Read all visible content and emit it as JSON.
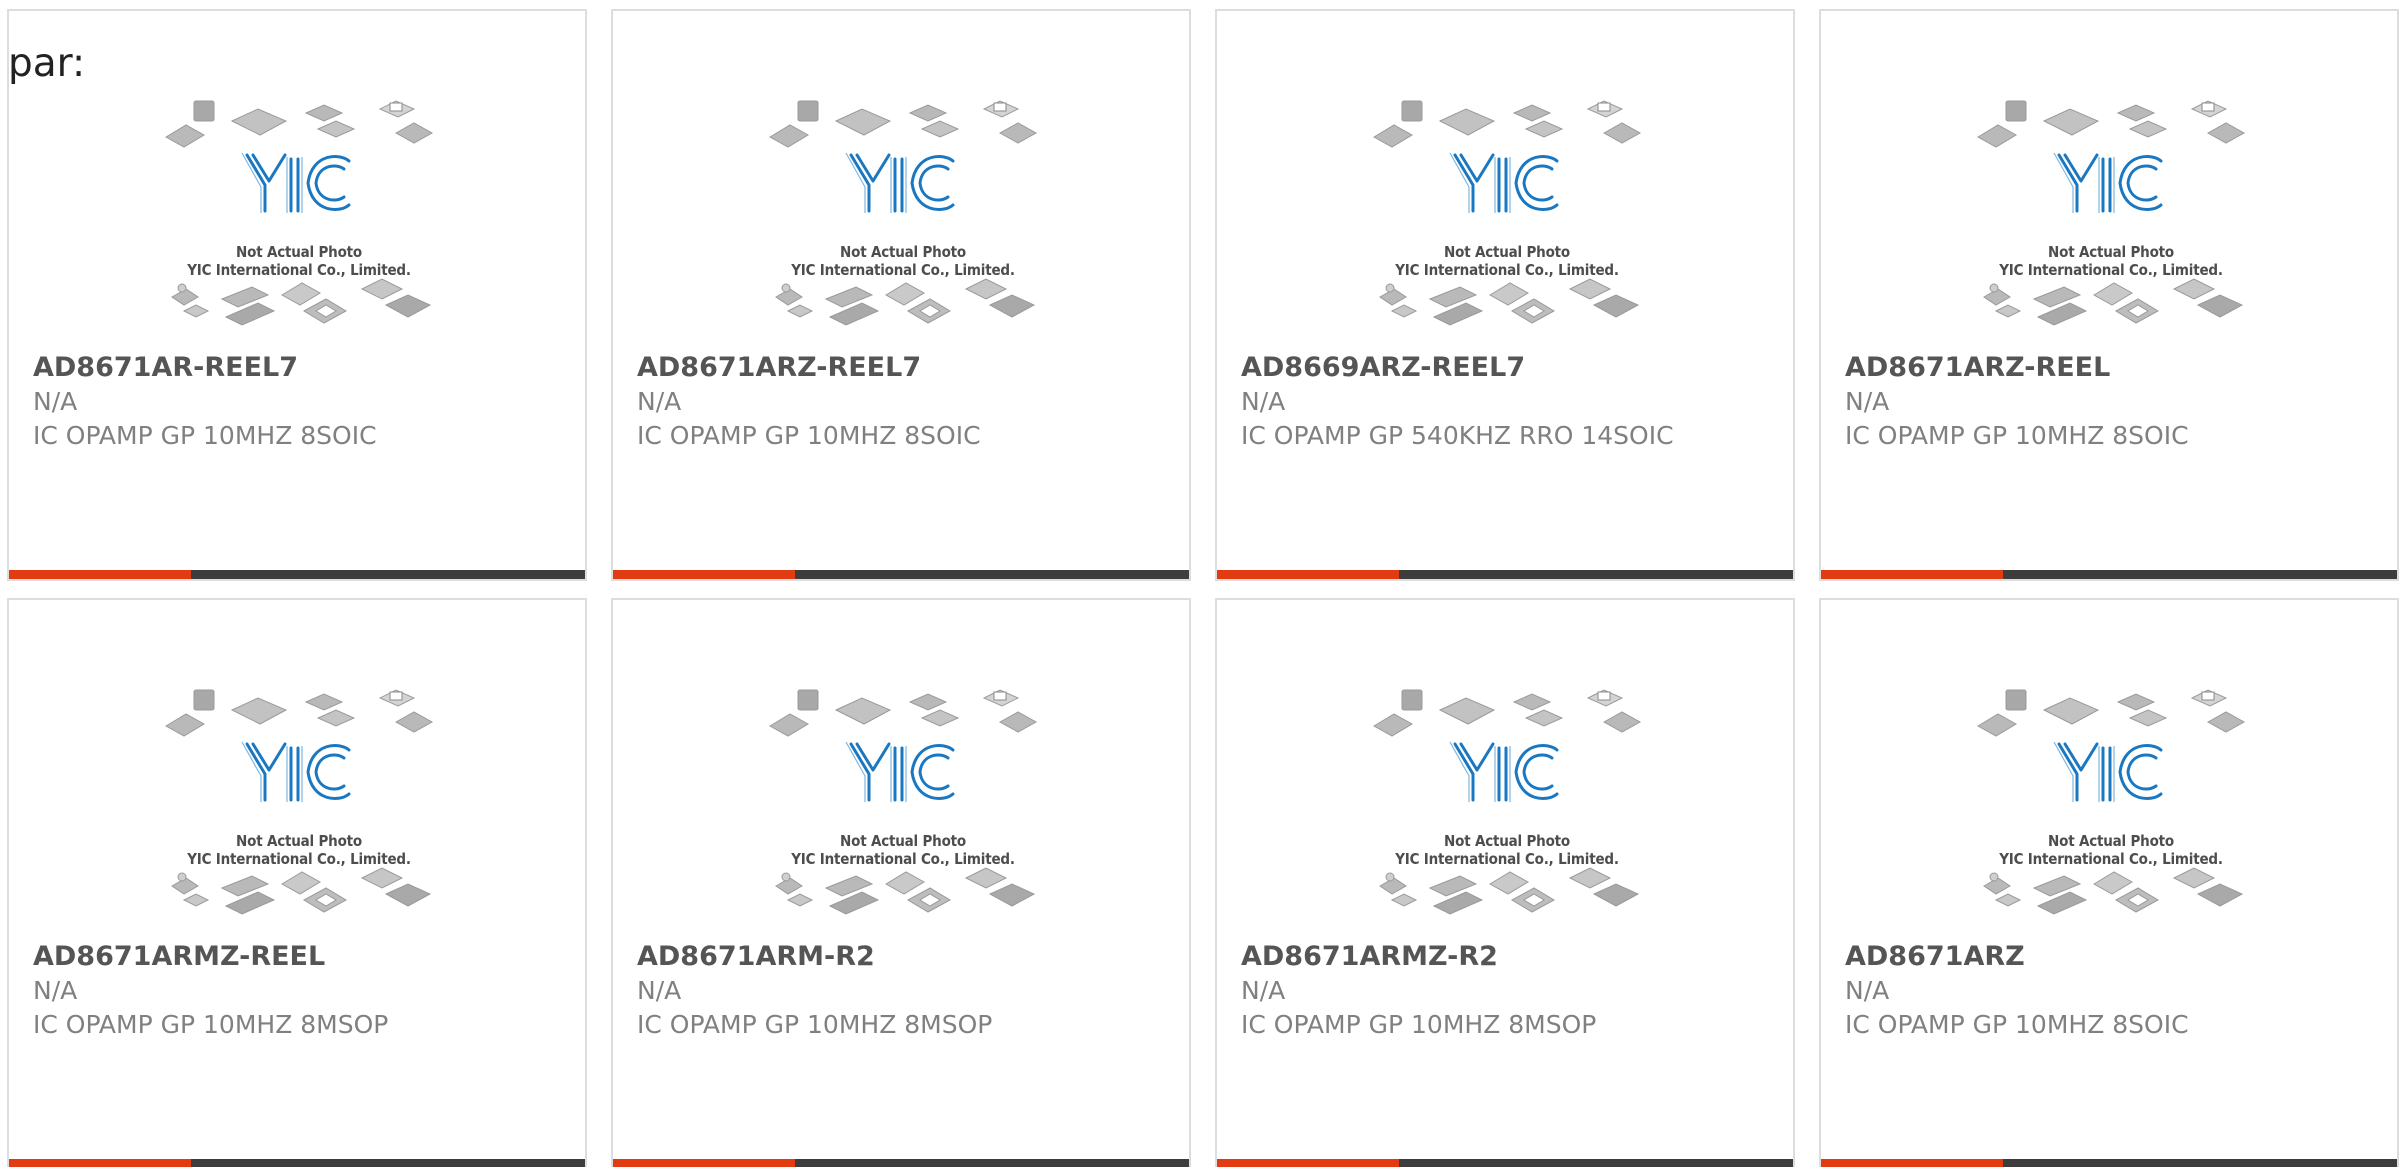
{
  "heading": "par:",
  "placeholder_image": {
    "logo_text": "YIC",
    "caption_line1": "Not Actual Photo",
    "caption_line2": "YIC International Co., Limited."
  },
  "colors": {
    "accent": "#e23b12",
    "bar": "#3d3d3d",
    "logo_blue": "#1a78c2"
  },
  "products": [
    {
      "part": "AD8671AR-REEL7",
      "mfr": "N/A",
      "desc": "IC OPAMP GP 10MHZ 8SOIC"
    },
    {
      "part": "AD8671ARZ-REEL7",
      "mfr": "N/A",
      "desc": "IC OPAMP GP 10MHZ 8SOIC"
    },
    {
      "part": "AD8669ARZ-REEL7",
      "mfr": "N/A",
      "desc": "IC OPAMP GP 540KHZ RRO 14SOIC"
    },
    {
      "part": "AD8671ARZ-REEL",
      "mfr": "N/A",
      "desc": "IC OPAMP GP 10MHZ 8SOIC"
    },
    {
      "part": "AD8671ARMZ-REEL",
      "mfr": "N/A",
      "desc": "IC OPAMP GP 10MHZ 8MSOP"
    },
    {
      "part": "AD8671ARM-R2",
      "mfr": "N/A",
      "desc": "IC OPAMP GP 10MHZ 8MSOP"
    },
    {
      "part": "AD8671ARMZ-R2",
      "mfr": "N/A",
      "desc": "IC OPAMP GP 10MHZ 8MSOP"
    },
    {
      "part": "AD8671ARZ",
      "mfr": "N/A",
      "desc": "IC OPAMP GP 10MHZ 8SOIC"
    }
  ]
}
